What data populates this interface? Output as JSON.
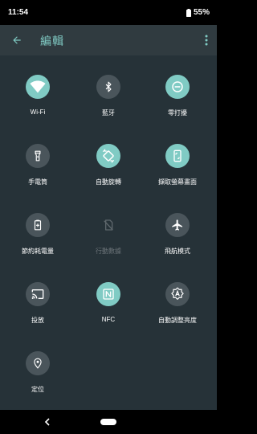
{
  "status_bar": {
    "time": "11:54",
    "battery": "55%",
    "icons": [
      "battery-icon"
    ]
  },
  "app_bar": {
    "title": "編輯",
    "back_icon": "arrow-left-icon",
    "menu_icon": "more-vertical-icon"
  },
  "colors": {
    "accent": "#80cbc4",
    "background": "#263238",
    "app_bar": "#303b40",
    "tile_off": "#4a555b",
    "disabled_text": "#6c7479"
  },
  "tiles": [
    {
      "label": "Wi-Fi",
      "icon": "wifi-icon",
      "state": "on"
    },
    {
      "label": "藍牙",
      "icon": "bluetooth-icon",
      "state": "off"
    },
    {
      "label": "零打擾",
      "icon": "do-not-disturb-icon",
      "state": "on"
    },
    {
      "label": "手電筒",
      "icon": "flashlight-icon",
      "state": "off"
    },
    {
      "label": "自動旋轉",
      "icon": "auto-rotate-icon",
      "state": "on"
    },
    {
      "label": "擷取螢幕畫面",
      "icon": "screenshot-icon",
      "state": "on"
    },
    {
      "label": "節約耗電量",
      "icon": "battery-saver-icon",
      "state": "off"
    },
    {
      "label": "行動數據",
      "icon": "mobile-data-off-icon",
      "state": "disabled"
    },
    {
      "label": "飛航模式",
      "icon": "airplane-icon",
      "state": "off"
    },
    {
      "label": "投放",
      "icon": "cast-icon",
      "state": "off"
    },
    {
      "label": "NFC",
      "icon": "nfc-icon",
      "state": "on"
    },
    {
      "label": "自動調整亮度",
      "icon": "auto-brightness-icon",
      "state": "off"
    },
    {
      "label": "定位",
      "icon": "location-icon",
      "state": "off"
    }
  ],
  "nav_bar": {
    "back_icon": "nav-back-icon",
    "home_icon": "nav-home-pill"
  }
}
